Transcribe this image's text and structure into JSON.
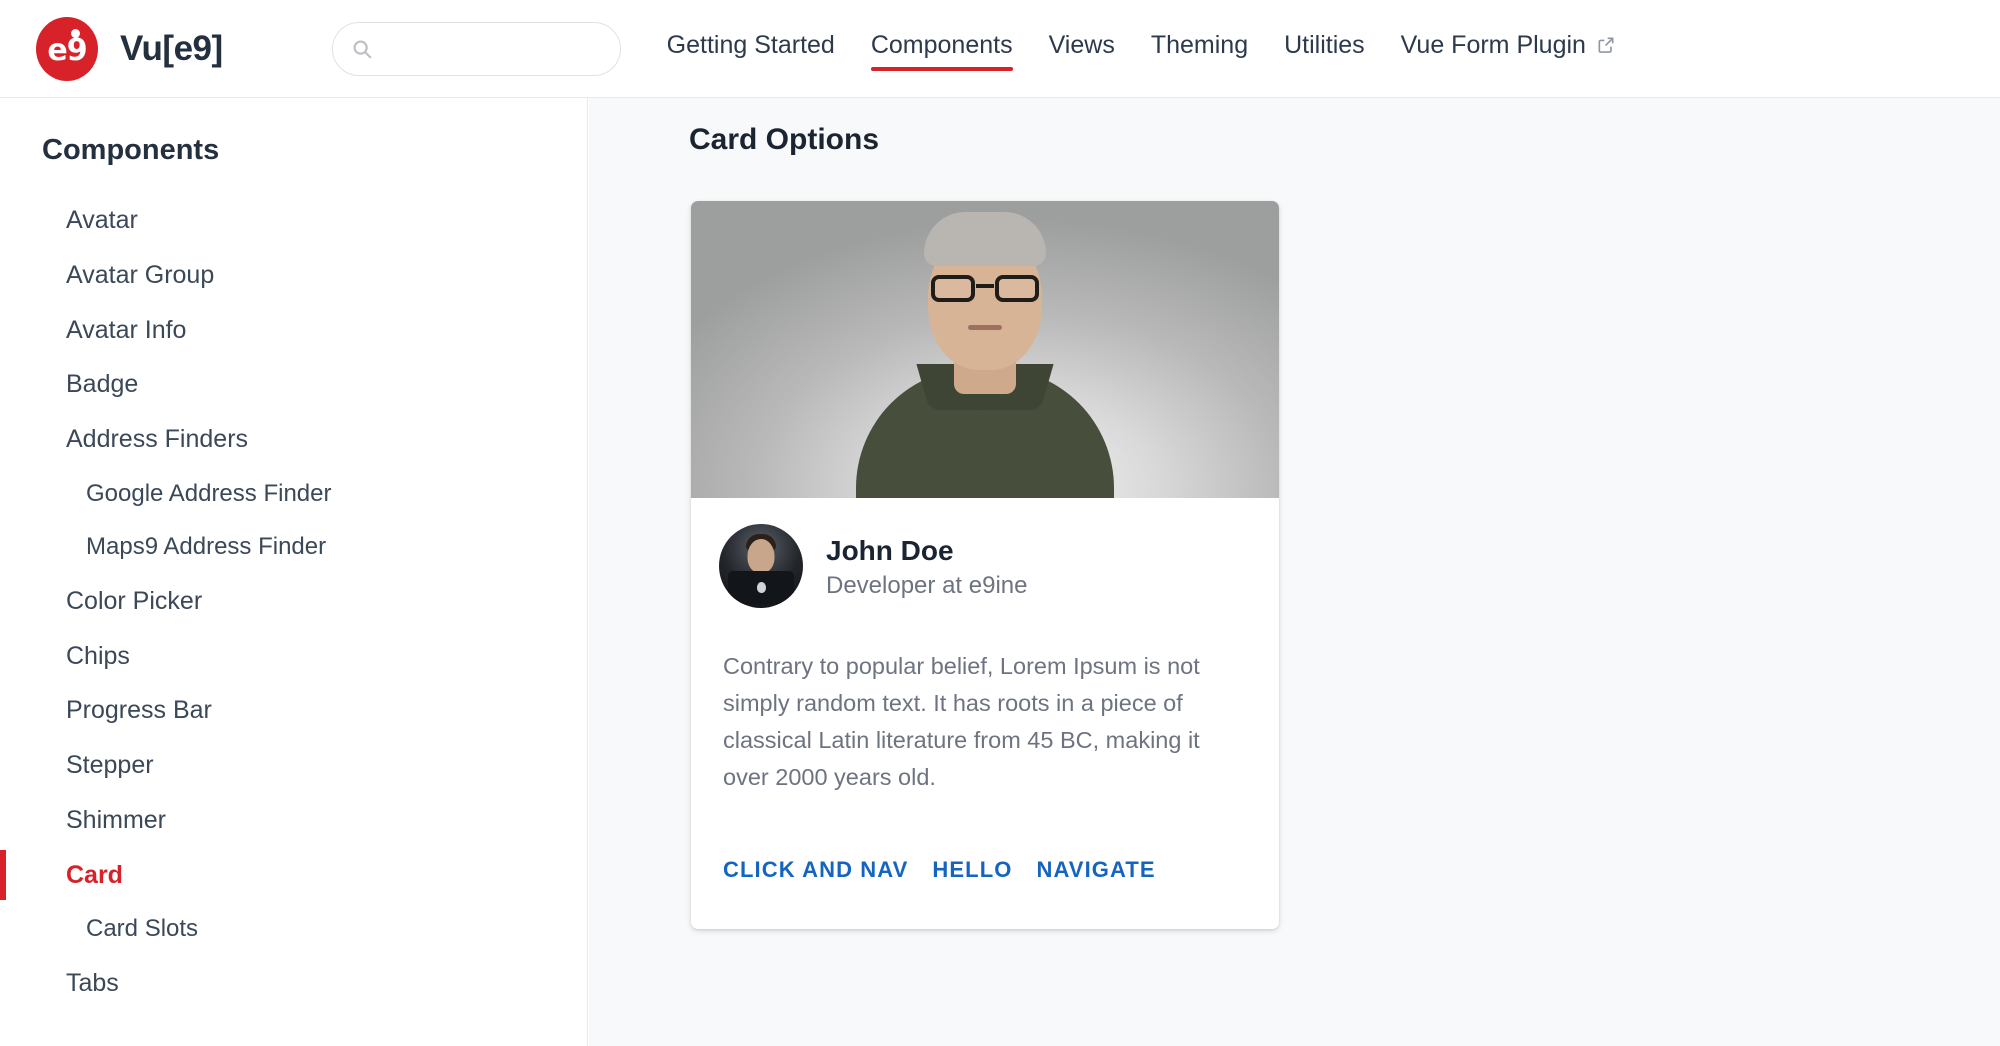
{
  "header": {
    "brand_name": "Vu[e9]",
    "logo_text": "e9",
    "search": {
      "value": "",
      "placeholder": ""
    },
    "nav": [
      {
        "label": "Getting Started",
        "active": false,
        "external": false
      },
      {
        "label": "Components",
        "active": true,
        "external": false
      },
      {
        "label": "Views",
        "active": false,
        "external": false
      },
      {
        "label": "Theming",
        "active": false,
        "external": false
      },
      {
        "label": "Utilities",
        "active": false,
        "external": false
      },
      {
        "label": "Vue Form Plugin",
        "active": false,
        "external": true
      }
    ]
  },
  "sidebar": {
    "title": "Components",
    "items": [
      {
        "label": "Avatar",
        "level": 0,
        "active": false
      },
      {
        "label": "Avatar Group",
        "level": 0,
        "active": false
      },
      {
        "label": "Avatar Info",
        "level": 0,
        "active": false
      },
      {
        "label": "Badge",
        "level": 0,
        "active": false
      },
      {
        "label": "Address Finders",
        "level": 0,
        "active": false
      },
      {
        "label": "Google Address Finder",
        "level": 1,
        "active": false
      },
      {
        "label": "Maps9 Address Finder",
        "level": 1,
        "active": false
      },
      {
        "label": "Color Picker",
        "level": 0,
        "active": false
      },
      {
        "label": "Chips",
        "level": 0,
        "active": false
      },
      {
        "label": "Progress Bar",
        "level": 0,
        "active": false
      },
      {
        "label": "Stepper",
        "level": 0,
        "active": false
      },
      {
        "label": "Shimmer",
        "level": 0,
        "active": false
      },
      {
        "label": "Card",
        "level": 0,
        "active": true
      },
      {
        "label": "Card Slots",
        "level": 1,
        "active": false
      },
      {
        "label": "Tabs",
        "level": 0,
        "active": false
      }
    ]
  },
  "main": {
    "page_title": "Card Options",
    "card": {
      "person_name": "John Doe",
      "person_role": "Developer at e9ine",
      "body_text": "Contrary to popular belief, Lorem Ipsum is not simply random text. It has roots in a piece of classical Latin literature from 45 BC, making it over 2000 years old.",
      "actions": [
        {
          "label": "CLICK AND NAV"
        },
        {
          "label": "HELLO"
        },
        {
          "label": "NAVIGATE"
        }
      ]
    }
  },
  "colors": {
    "brand_red": "#d7222a",
    "nav_text": "#2c3a4b",
    "link_blue": "#1565c0",
    "muted_text": "#6d7480",
    "page_bg": "#f8f9fa"
  }
}
